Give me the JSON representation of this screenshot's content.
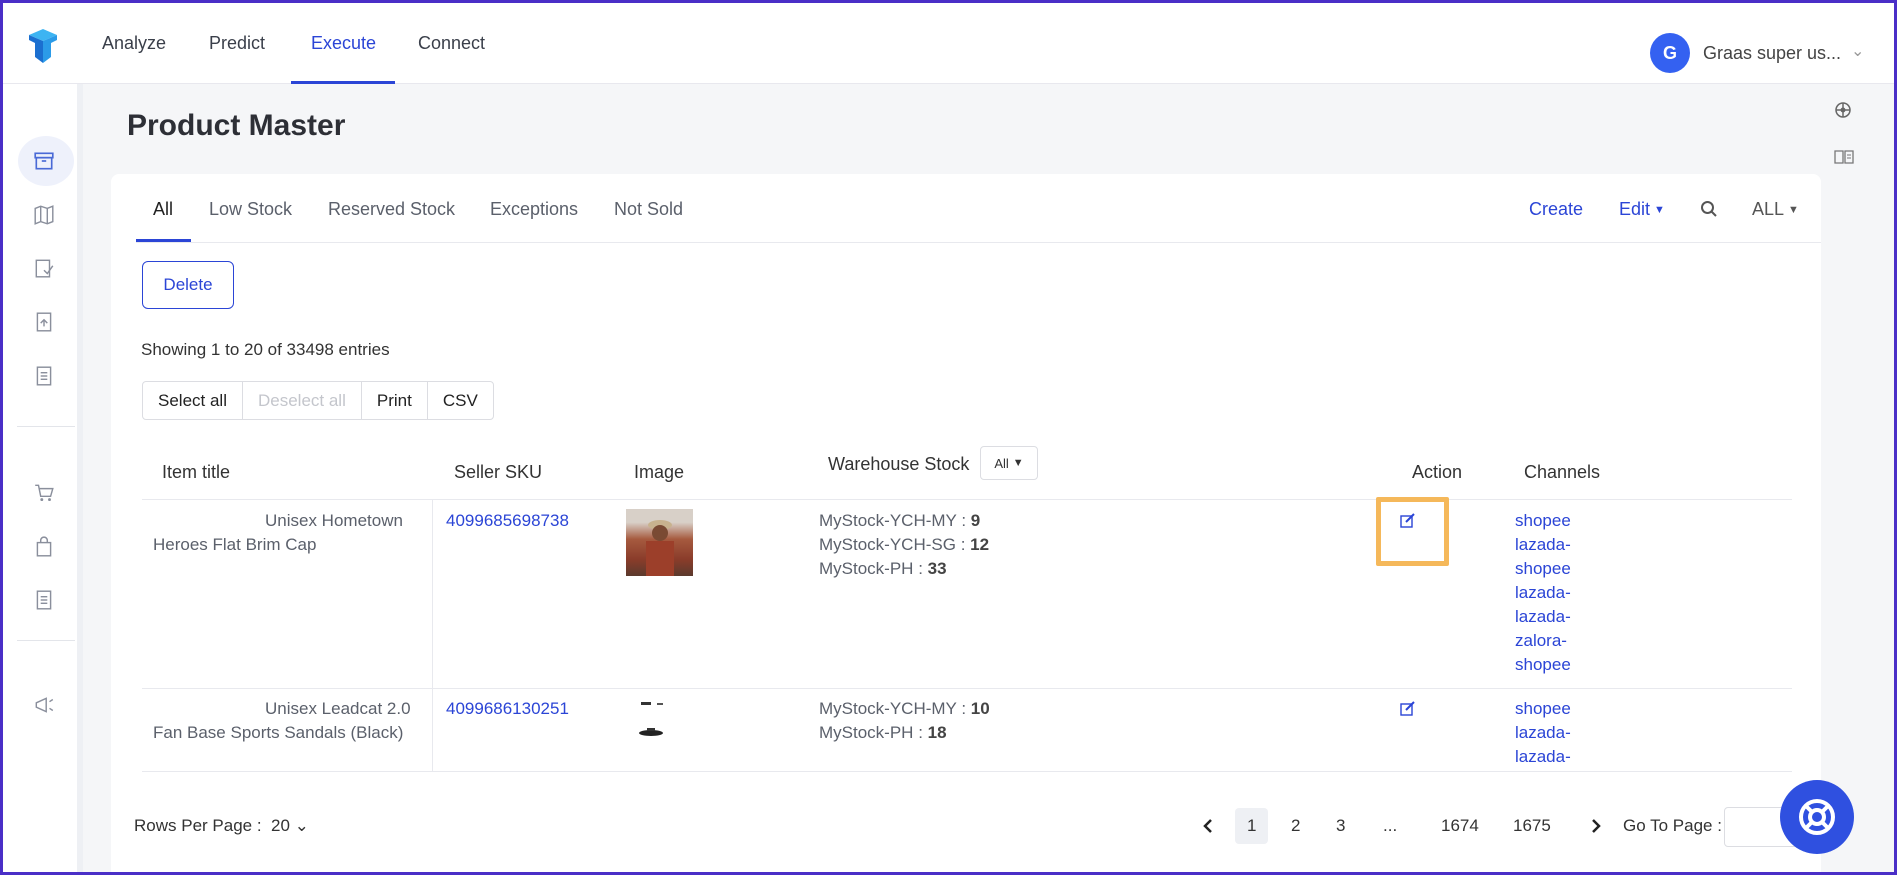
{
  "nav": {
    "items": [
      {
        "label": "Analyze"
      },
      {
        "label": "Predict"
      },
      {
        "label": "Execute"
      },
      {
        "label": "Connect"
      }
    ],
    "active": "Execute"
  },
  "user": {
    "initial": "G",
    "name": "Graas super us..."
  },
  "page": {
    "title": "Product Master"
  },
  "tabs": [
    {
      "label": "All"
    },
    {
      "label": "Low Stock"
    },
    {
      "label": "Reserved Stock"
    },
    {
      "label": "Exceptions"
    },
    {
      "label": "Not Sold"
    }
  ],
  "actions": {
    "create": "Create",
    "edit": "Edit",
    "filter": "ALL"
  },
  "toolbar": {
    "delete": "Delete",
    "showing": "Showing 1 to 20 of 33498 entries",
    "select_all": "Select all",
    "deselect_all": "Deselect all",
    "print": "Print",
    "csv": "CSV"
  },
  "table": {
    "headers": {
      "item_title": "Item title",
      "seller_sku": "Seller SKU",
      "image": "Image",
      "warehouse_stock": "Warehouse Stock",
      "warehouse_filter": "All",
      "action": "Action",
      "channels": "Channels"
    },
    "rows": [
      {
        "title": "Unisex Hometown Heroes Flat Brim Cap",
        "sku": "4099685698738",
        "stock": [
          {
            "name": "MyStock-YCH-MY",
            "qty": "9"
          },
          {
            "name": "MyStock-YCH-SG",
            "qty": "12"
          },
          {
            "name": "MyStock-PH",
            "qty": "33"
          }
        ],
        "channels": [
          "shopee",
          "lazada-",
          "shopee",
          "lazada-",
          "lazada-",
          "zalora-",
          "shopee"
        ]
      },
      {
        "title": "Unisex Leadcat 2.0 Fan Base Sports Sandals (Black)",
        "sku": "4099686130251",
        "stock": [
          {
            "name": "MyStock-YCH-MY",
            "qty": "10"
          },
          {
            "name": "MyStock-PH",
            "qty": "18"
          }
        ],
        "channels": [
          "shopee",
          "lazada-",
          "lazada-"
        ]
      }
    ]
  },
  "pagination": {
    "rows_per_page_label": "Rows Per Page :",
    "rows_per_page": "20",
    "pages": [
      "1",
      "2",
      "3",
      "...",
      "1674",
      "1675"
    ],
    "current": "1",
    "goto_label": "Go To Page :"
  },
  "colors": {
    "accent": "#2b45d6",
    "highlight": "#f5b85a",
    "frame": "#4a2fc7"
  }
}
